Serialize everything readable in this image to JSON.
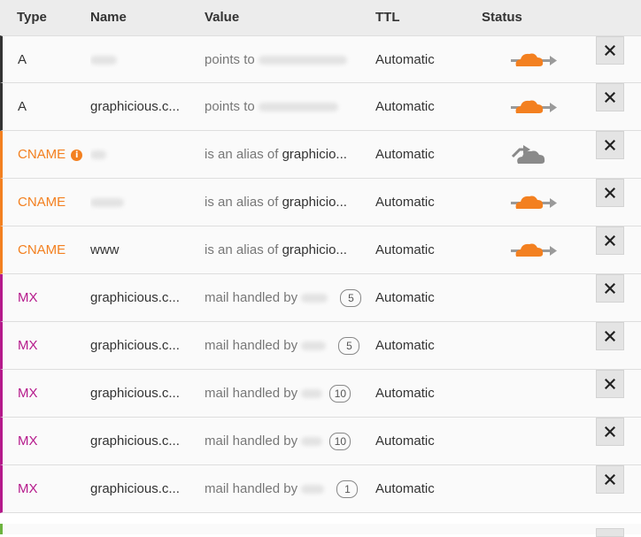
{
  "header": {
    "type": "Type",
    "name": "Name",
    "value": "Value",
    "ttl": "TTL",
    "status": "Status"
  },
  "rows": [
    {
      "type": "A",
      "name": "",
      "value_prefix": "points to",
      "value_target": "",
      "priority": "",
      "ttl": "Automatic",
      "status": "proxied",
      "has_info": false,
      "record_class": "t-a"
    },
    {
      "type": "A",
      "name": "graphicious.c...",
      "value_prefix": "points to",
      "value_target": "",
      "priority": "",
      "ttl": "Automatic",
      "status": "proxied",
      "has_info": false,
      "record_class": "t-a"
    },
    {
      "type": "CNAME",
      "name": "",
      "value_prefix": "is an alias of",
      "value_target": "graphicio...",
      "priority": "",
      "ttl": "Automatic",
      "status": "dns-only",
      "has_info": true,
      "record_class": "t-cname"
    },
    {
      "type": "CNAME",
      "name": "",
      "value_prefix": "is an alias of",
      "value_target": "graphicio...",
      "priority": "",
      "ttl": "Automatic",
      "status": "proxied",
      "has_info": false,
      "record_class": "t-cname"
    },
    {
      "type": "CNAME",
      "name": "www",
      "value_prefix": "is an alias of",
      "value_target": "graphicio...",
      "priority": "",
      "ttl": "Automatic",
      "status": "proxied",
      "has_info": false,
      "record_class": "t-cname"
    },
    {
      "type": "MX",
      "name": "graphicious.c...",
      "value_prefix": "mail handled by",
      "value_target": "",
      "priority": "5",
      "ttl": "Automatic",
      "status": "",
      "has_info": false,
      "record_class": "t-mx"
    },
    {
      "type": "MX",
      "name": "graphicious.c...",
      "value_prefix": "mail handled by",
      "value_target": "",
      "priority": "5",
      "ttl": "Automatic",
      "status": "",
      "has_info": false,
      "record_class": "t-mx"
    },
    {
      "type": "MX",
      "name": "graphicious.c...",
      "value_prefix": "mail handled by",
      "value_target": "",
      "priority": "10",
      "ttl": "Automatic",
      "status": "",
      "has_info": false,
      "record_class": "t-mx"
    },
    {
      "type": "MX",
      "name": "graphicious.c...",
      "value_prefix": "mail handled by",
      "value_target": "",
      "priority": "10",
      "ttl": "Automatic",
      "status": "",
      "has_info": false,
      "record_class": "t-mx"
    },
    {
      "type": "MX",
      "name": "graphicious.c...",
      "value_prefix": "mail handled by",
      "value_target": "",
      "priority": "1",
      "ttl": "Automatic",
      "status": "",
      "has_info": false,
      "record_class": "t-mx"
    }
  ],
  "colors": {
    "proxied_cloud": "#f38020",
    "dns_only_cloud": "#8a8a8a",
    "a_accent": "#333333",
    "cname_accent": "#f38020",
    "mx_accent": "#b5198b"
  },
  "icons": {
    "delete": "close-icon",
    "proxied": "orange-cloud-icon",
    "dns_only": "grey-cloud-icon",
    "info": "info-icon"
  },
  "info_glyph": "i"
}
